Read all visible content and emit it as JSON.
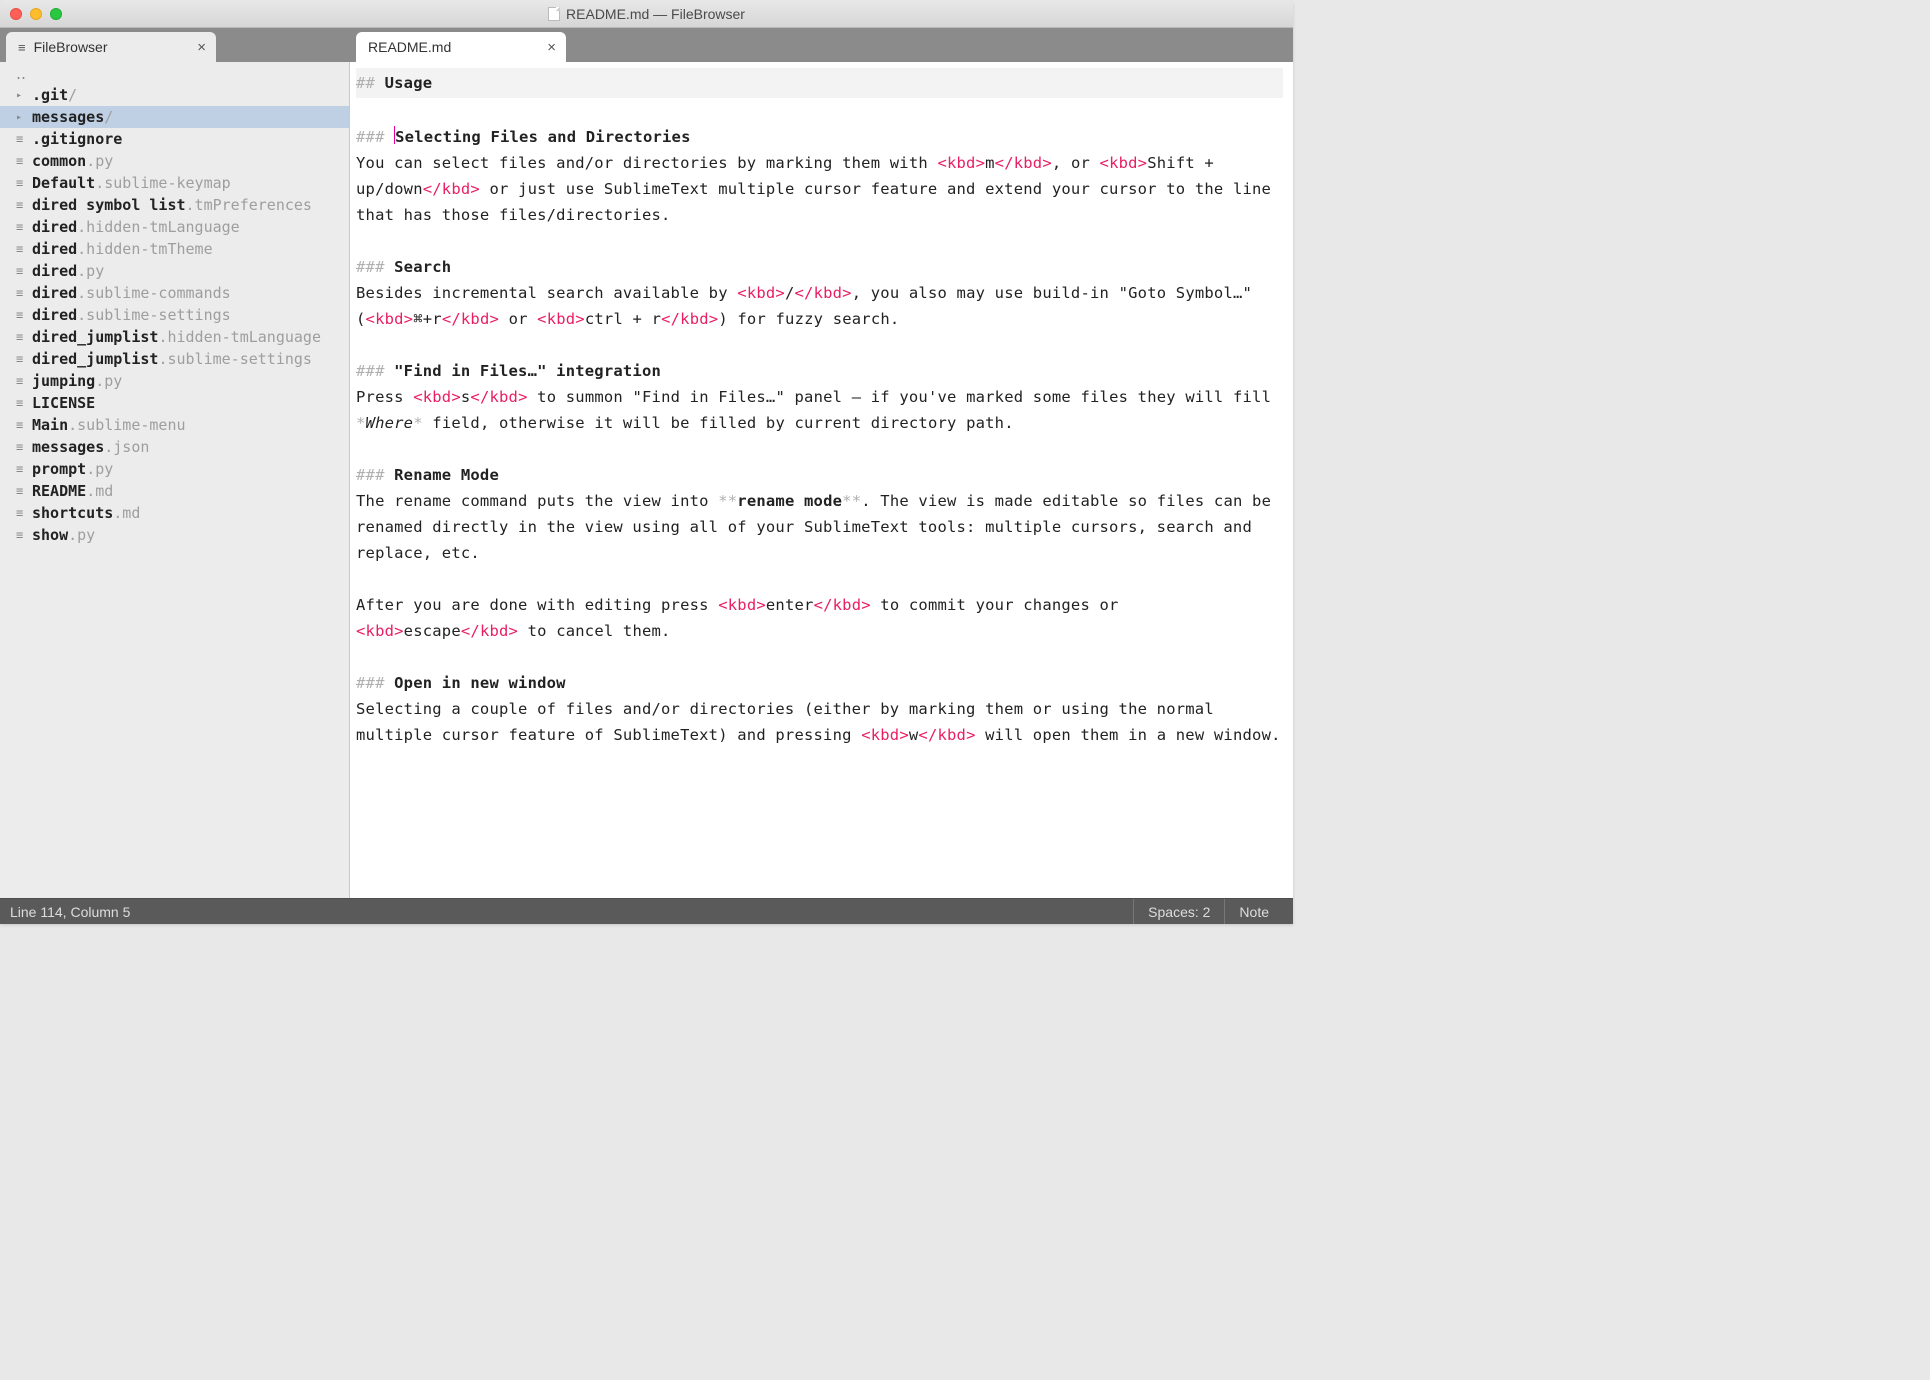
{
  "window": {
    "title": "README.md — FileBrowser"
  },
  "tabs": {
    "left": {
      "label": "FileBrowser"
    },
    "right": {
      "label": "README.md"
    }
  },
  "sidebar": {
    "updots": "‥",
    "items": [
      {
        "marker": "▸",
        "name": ".git",
        "ext": "/",
        "dir": true
      },
      {
        "marker": "▸",
        "name": "messages",
        "ext": "/",
        "dir": true,
        "selected": true
      },
      {
        "marker": "≡",
        "name": ".gitignore",
        "ext": ""
      },
      {
        "marker": "≡",
        "name": "common",
        "ext": ".py"
      },
      {
        "marker": "≡",
        "name": "Default",
        "ext": ".sublime-keymap"
      },
      {
        "marker": "≡",
        "name": "dired symbol list",
        "ext": ".tmPreferences"
      },
      {
        "marker": "≡",
        "name": "dired",
        "ext": ".hidden-tmLanguage"
      },
      {
        "marker": "≡",
        "name": "dired",
        "ext": ".hidden-tmTheme"
      },
      {
        "marker": "≡",
        "name": "dired",
        "ext": ".py"
      },
      {
        "marker": "≡",
        "name": "dired",
        "ext": ".sublime-commands"
      },
      {
        "marker": "≡",
        "name": "dired",
        "ext": ".sublime-settings"
      },
      {
        "marker": "≡",
        "name": "dired_jumplist",
        "ext": ".hidden-tmLanguage"
      },
      {
        "marker": "≡",
        "name": "dired_jumplist",
        "ext": ".sublime-settings"
      },
      {
        "marker": "≡",
        "name": "jumping",
        "ext": ".py"
      },
      {
        "marker": "≡",
        "name": "LICENSE",
        "ext": ""
      },
      {
        "marker": "≡",
        "name": "Main",
        "ext": ".sublime-menu"
      },
      {
        "marker": "≡",
        "name": "messages",
        "ext": ".json"
      },
      {
        "marker": "≡",
        "name": "prompt",
        "ext": ".py"
      },
      {
        "marker": "≡",
        "name": "README",
        "ext": ".md"
      },
      {
        "marker": "≡",
        "name": "shortcuts",
        "ext": ".md"
      },
      {
        "marker": "≡",
        "name": "show",
        "ext": ".py"
      }
    ]
  },
  "editor": {
    "h2_hash": "## ",
    "h2_usage": "Usage",
    "h3_hash": "### ",
    "sec1_title": "Selecting Files and Directories",
    "sec1_p1a": "You can select files and/or directories by marking them with ",
    "kbd_open": "<kbd>",
    "kbd_close": "</kbd>",
    "sec1_m": "m",
    "sec1_p1b": ", or ",
    "sec1_shift": "Shift + up/down",
    "sec1_p1c": " or just use SublimeText multiple cursor feature and extend your cursor to the line that has those files/directories.",
    "sec2_title": "Search",
    "sec2_p1a": "Besides incremental search available by ",
    "sec2_slash": "/",
    "sec2_p1b": ", you also may use build-in \"Goto Symbol…\" (",
    "sec2_cmdr": "⌘+r",
    "sec2_or": " or ",
    "sec2_ctrlr": "ctrl + r",
    "sec2_p1c": ") for fuzzy search.",
    "sec3_title": "\"Find in Files…\" integration",
    "sec3_p1a": "Press ",
    "sec3_s": "s",
    "sec3_p1b": " to summon \"Find in Files…\" panel — if you've marked some files they will fill ",
    "sec3_where_star": "*",
    "sec3_where": "Where",
    "sec3_p1c": " field, otherwise it will be filled by current directory path.",
    "sec4_title": "Rename Mode",
    "sec4_p1a": "The rename command puts the view into ",
    "sec4_star": "**",
    "sec4_rename": "rename mode",
    "sec4_p1b": ". The view is made editable so files can be renamed directly in the view using all of your SublimeText tools: multiple cursors, search and replace, etc.",
    "sec4_p2a": "After you are done with editing press ",
    "sec4_enter": "enter",
    "sec4_p2b": " to commit your changes or ",
    "sec4_escape": "escape",
    "sec4_p2c": " to cancel them.",
    "sec5_title": "Open in new window",
    "sec5_p1a": "Selecting a couple of files and/or directories (either by marking them or using the normal multiple cursor feature of SublimeText) and pressing ",
    "sec5_w": "w",
    "sec5_p1b": " will open them in a new window."
  },
  "status": {
    "position": "Line 114, Column 5",
    "spaces": "Spaces: 2",
    "syntax": "Note"
  }
}
